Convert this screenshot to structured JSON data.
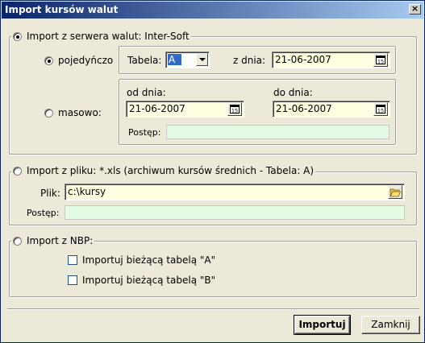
{
  "window": {
    "title": "Import kursów walut",
    "close_glyph": "×"
  },
  "server_group": {
    "label": "Import z serwera walut: Inter-Soft",
    "mode_single": {
      "label": "pojedyńczo",
      "table_label": "Tabela:",
      "table_value": "A",
      "date_label": "z dnia:",
      "date_value": "21-06-2007"
    },
    "mode_bulk": {
      "label": "masowo:",
      "from_label": "od dnia:",
      "from_value": "21-06-2007",
      "to_label": "do dnia:",
      "to_value": "21-06-2007",
      "progress_label": "Postęp:",
      "progress": 0
    }
  },
  "file_group": {
    "label": "Import z pliku: *.xls (archiwum kursów średnich - Tabela: A)",
    "file_label": "Plik:",
    "file_value": "c:\\kursy",
    "progress_label": "Postęp:",
    "progress": 0
  },
  "nbp_group": {
    "label": "Import z NBP:",
    "option_a": "Importuj bieżącą tabelą \"A\"",
    "option_b": "Importuj bieżącą tabelą \"B\""
  },
  "buttons": {
    "import": "Importuj",
    "close": "Zamknij"
  },
  "icons": {
    "calendar": "calendar-icon",
    "folder": "folder-open-icon",
    "dropdown": "chevron-down-icon"
  },
  "colors": {
    "title_start": "#0a246a",
    "title_end": "#a6caf0",
    "field_bg": "#ffffe1",
    "progress_bg": "#e2fbe2"
  }
}
